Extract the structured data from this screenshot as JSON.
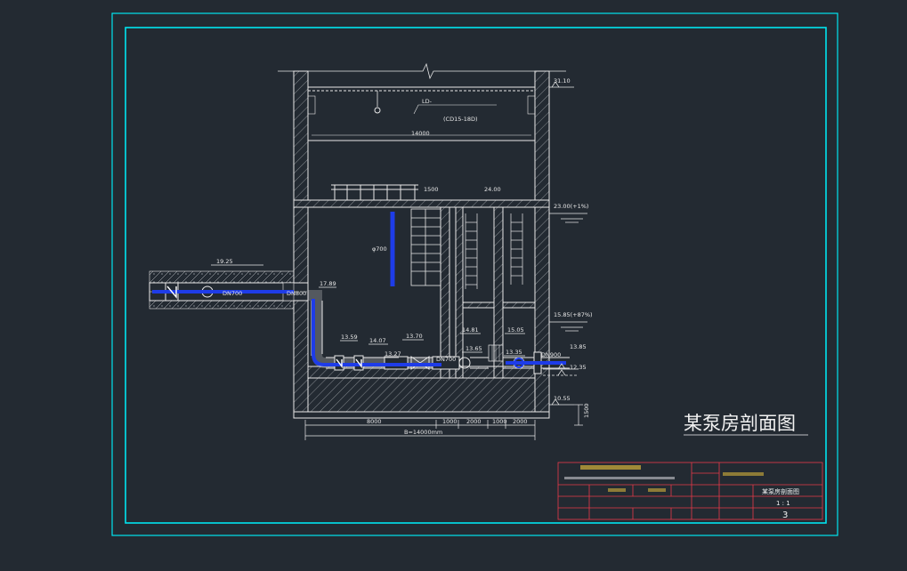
{
  "drawing": {
    "title": "某泵房剖面图",
    "crane_label": "LD-",
    "crane_spec": "(CD15-18D)",
    "crane_span": "14000",
    "width_1500": "1500",
    "elev_roof": "31.10",
    "elev_floor": "24.00",
    "elev_ground": "23.00(+1%)",
    "elev_inlet": "19.25",
    "elev_1789": "17.89",
    "elev_1585": "15.85(+87%)",
    "elev_1481": "14.81",
    "elev_1505": "15.05",
    "elev_1359": "13.59",
    "elev_1407": "14.07",
    "elev_1370": "13.70",
    "elev_1327": "13.27",
    "elev_1365": "13.65",
    "elev_1335": "13.35",
    "elev_1385": "13.85",
    "elev_1235": "12.35",
    "elev_1055": "10.55",
    "dn700_a": "DN700",
    "dn800": "DN800",
    "dn700_b": "DN700",
    "dn900": "DN900",
    "vert_pipe": "φ700",
    "dim_base": "1500",
    "dim_8000": "8000",
    "dim_1000": "1000",
    "dim_2000a": "2000",
    "dim_1000b": "1000",
    "dim_2000b": "2000",
    "dim_total": "B=14000mm",
    "tb_drawing_name": "某泵房剖面图",
    "tb_scale": "1 : 1",
    "tb_sheet": "3"
  }
}
